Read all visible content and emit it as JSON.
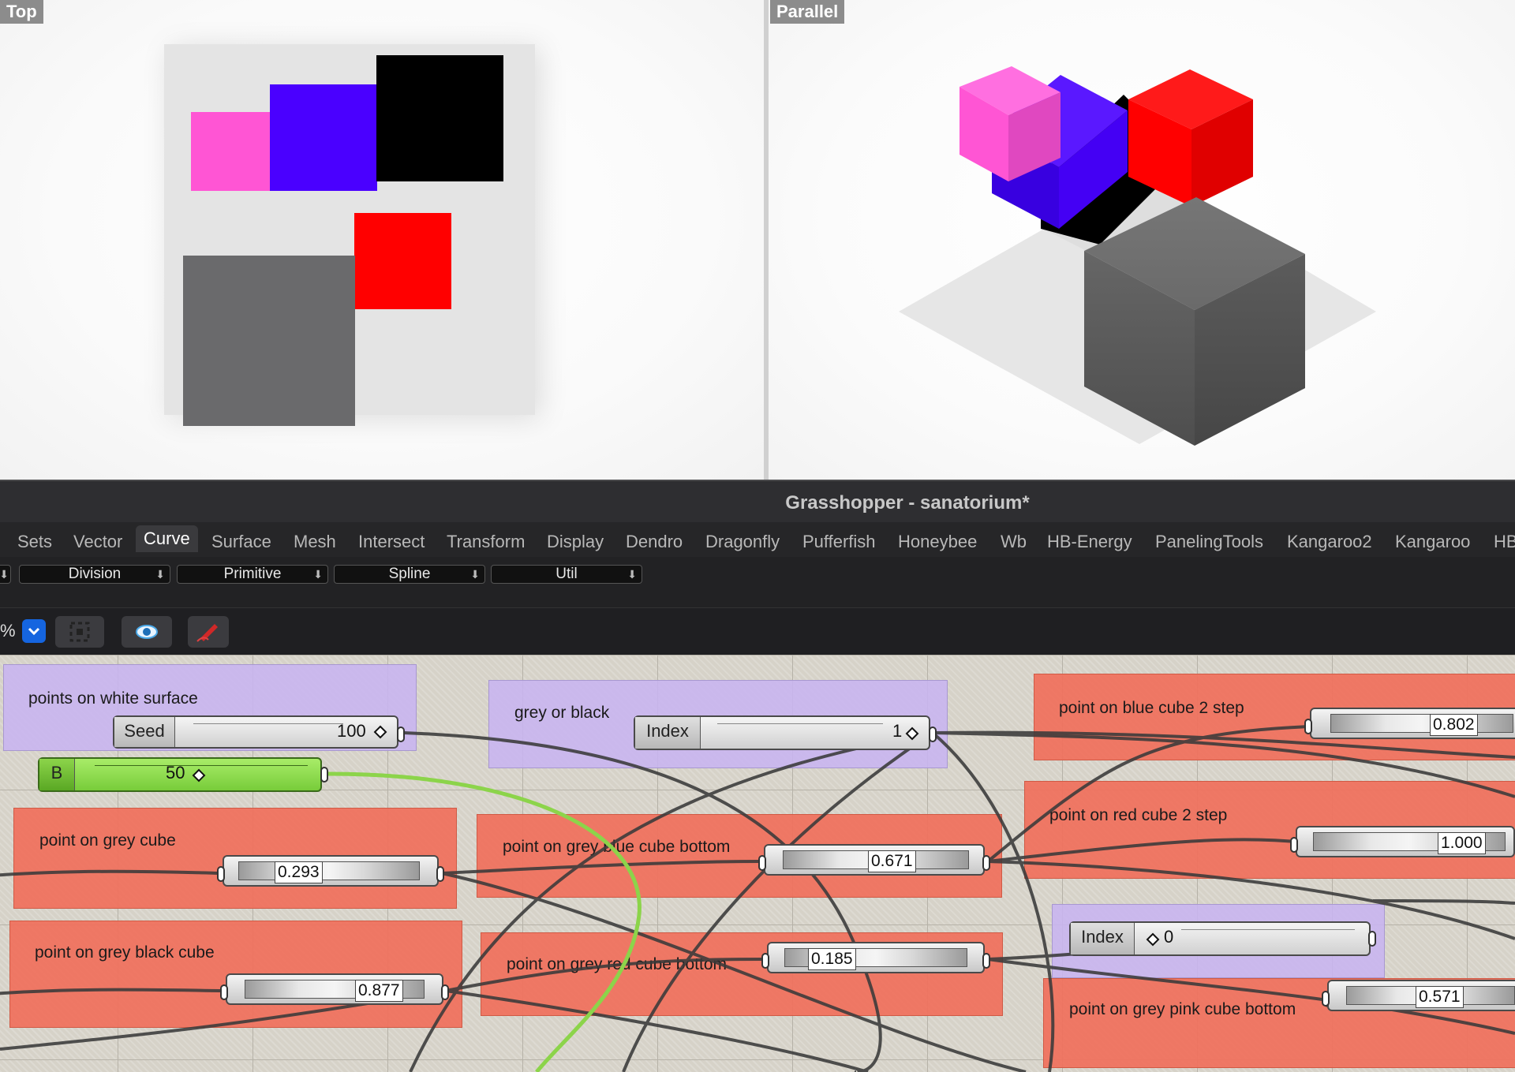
{
  "viewports": {
    "top": {
      "label": "Top"
    },
    "parallel": {
      "label": "Parallel"
    }
  },
  "window": {
    "title": "Grasshopper - sanatorium*"
  },
  "tabs": [
    "Sets",
    "Vector",
    "Curve",
    "Surface",
    "Mesh",
    "Intersect",
    "Transform",
    "Display",
    "Dendro",
    "Dragonfly",
    "Pufferfish",
    "Honeybee",
    "Wb",
    "HB-Energy",
    "PanelingTools",
    "Kangaroo2",
    "Kangaroo",
    "HB"
  ],
  "active_tab": "Curve",
  "groups": [
    "Division",
    "Primitive",
    "Spline",
    "Util"
  ],
  "toolbar": {
    "zoom_suffix": "%"
  },
  "canvas": {
    "groups": {
      "white_surface": "points on white surface",
      "grey_or_black": "grey or black",
      "blue_2step": "point on blue cube 2 step",
      "red_2step": "point on red cube 2 step",
      "grey_cube": "point on grey cube",
      "grey_blue_bottom": "point on grey blue cube bottom",
      "grey_black_cube": "point on grey black cube",
      "grey_red_bottom": "point on grey red cube bottom",
      "grey_pink_bottom": "point on grey pink cube bottom"
    },
    "number_sliders": {
      "seed": {
        "label": "Seed",
        "value": "100"
      },
      "b": {
        "label": "B",
        "value": "50"
      },
      "index1": {
        "label": "Index",
        "value": "1"
      },
      "index0": {
        "label": "Index",
        "value": "0"
      }
    },
    "param_sliders": {
      "blue_2step": "0.802",
      "red_2step": "1.000",
      "grey_cube": "0.293",
      "grey_blue_bottom": "0.671",
      "grey_black_cube": "0.877",
      "grey_red_bottom": "0.185",
      "grey_pink_bottom": "0.571"
    }
  },
  "colors": {
    "pink": "#ff55d4",
    "blue": "#4a00ff",
    "black": "#000000",
    "red": "#ff0000",
    "grey": "#6a6a6a",
    "green": "#8cd44a",
    "group_red": "#f0705c",
    "group_purple": "#c8b4f0"
  }
}
